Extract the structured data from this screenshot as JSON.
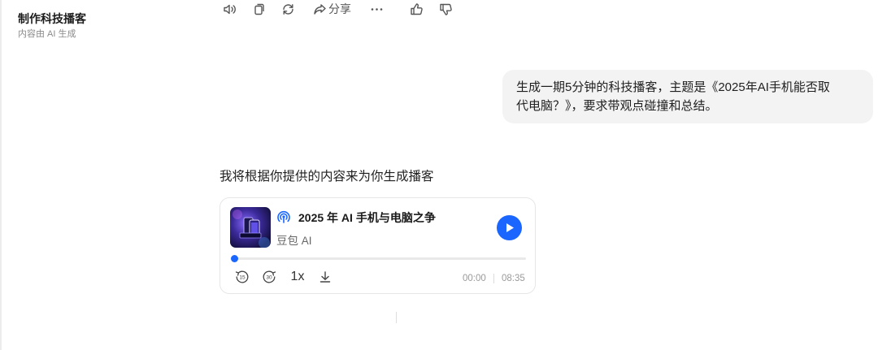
{
  "header": {
    "title": "制作科技播客",
    "subtitle": "内容由 AI 生成"
  },
  "user_message": {
    "line1": "生成一期5分钟的科技播客，主题是《2025年AI手机能否取",
    "line2": "代电脑？》，要求带观点碰撞和总结。"
  },
  "assistant": {
    "reply": "我将根据你提供的内容来为你生成播客"
  },
  "podcast_card": {
    "title": "2025 年 AI 手机与电脑之争",
    "author": "豆包 AI",
    "speed": "1x",
    "current_time": "00:00",
    "duration": "08:35",
    "progress_fraction": 0,
    "accent_color": "#1a66ff",
    "icons": {
      "podcast": "podcast-broadcast-icon",
      "play": "play-icon",
      "rewind": "rewind-15-icon",
      "forward": "forward-30-icon",
      "download": "download-icon"
    }
  },
  "actions": {
    "share_label": "分享",
    "icons": [
      "speaker-icon",
      "copy-icon",
      "regenerate-icon",
      "share-icon",
      "more-icon",
      "thumbs-up-icon",
      "thumbs-down-icon"
    ]
  }
}
